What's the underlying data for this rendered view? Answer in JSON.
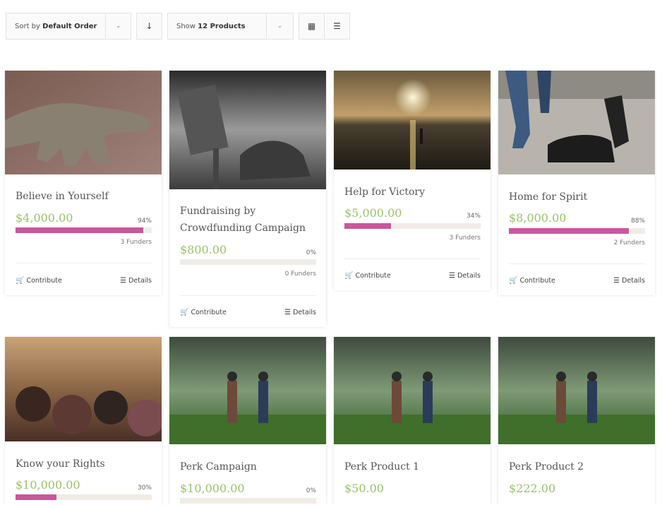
{
  "toolbar": {
    "sort_prefix": "Sort by",
    "sort_value": "Default Order",
    "show_prefix": "Show",
    "show_value": "12 Products"
  },
  "labels": {
    "contribute": "Contribute",
    "details": "Details"
  },
  "colors": {
    "price_green": "#9bc26a",
    "progress_pink": "#c9579d",
    "progress_track": "#f1ede6"
  },
  "products": [
    {
      "title": "Believe in Yourself",
      "price": "$4,000.00",
      "percent": "94%",
      "progress": 0.94,
      "funders": "3 Funders"
    },
    {
      "title": "Fundraising by Crowdfunding Campaign",
      "price": "$800.00",
      "percent": "0%",
      "progress": 0,
      "funders": "0 Funders"
    },
    {
      "title": "Help for Victory",
      "price": "$5,000.00",
      "percent": "34%",
      "progress": 0.34,
      "funders": "3 Funders"
    },
    {
      "title": "Home for Spirit",
      "price": "$8,000.00",
      "percent": "88%",
      "progress": 0.88,
      "funders": "2 Funders"
    },
    {
      "title": "Know your Rights",
      "price": "$10,000.00",
      "percent": "30%",
      "progress": 0.3
    },
    {
      "title": "Perk Campaign",
      "price": "$10,000.00",
      "percent": "0%",
      "progress": 0
    },
    {
      "title": "Perk Product 1",
      "price": "$50.00"
    },
    {
      "title": "Perk Product 2",
      "price": "$222.00"
    }
  ]
}
